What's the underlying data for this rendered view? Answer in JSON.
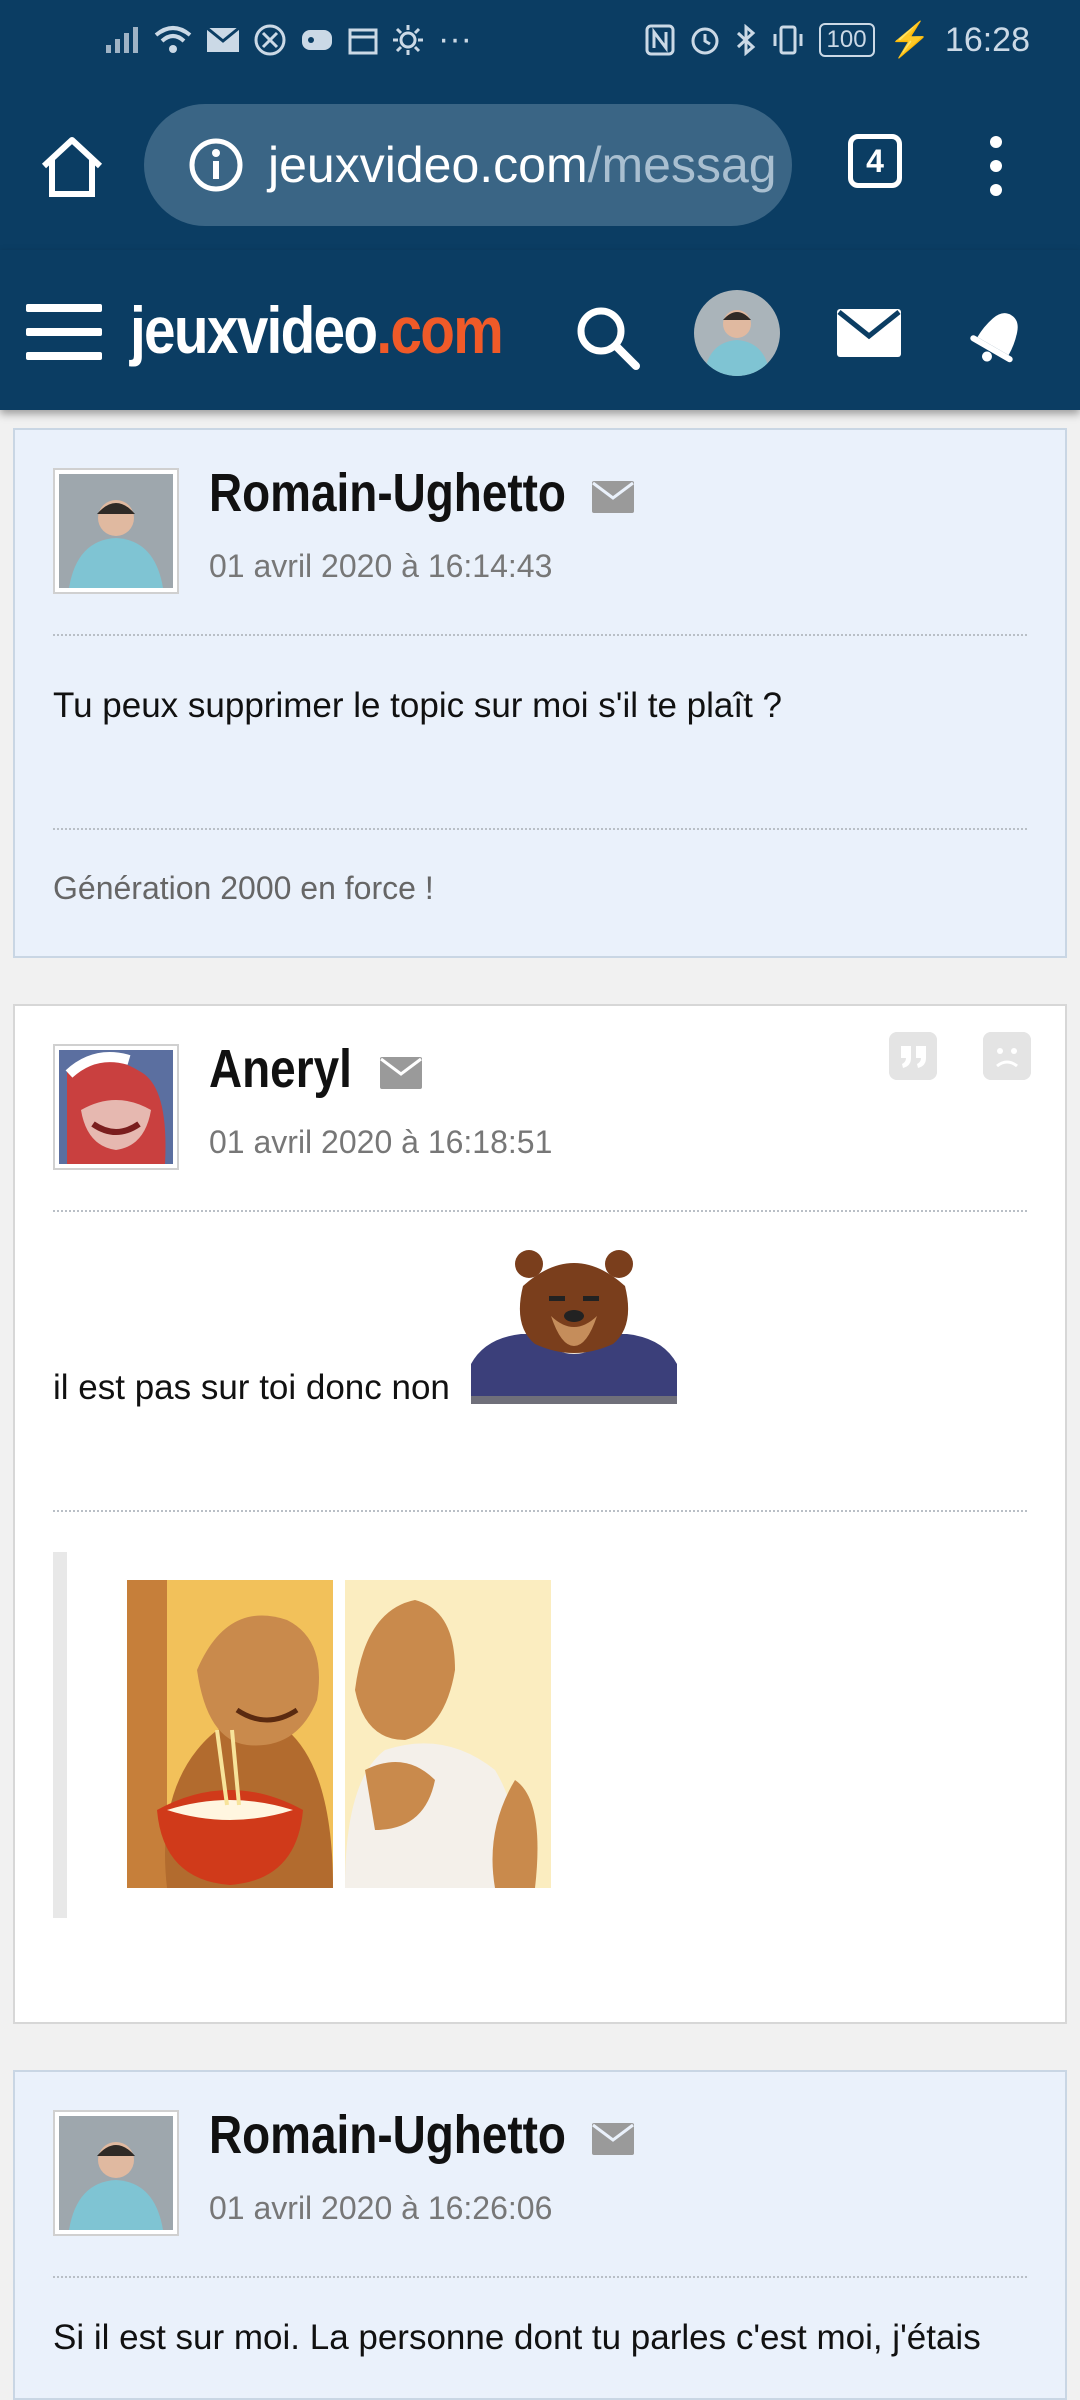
{
  "status_bar": {
    "battery": "100",
    "time": "16:28"
  },
  "browser": {
    "url_domain": "jeuxvideo.com",
    "url_path": "/messag",
    "tab_count": "4"
  },
  "site": {
    "logo_main": "jeuxvideo",
    "logo_suffix": ".com"
  },
  "posts": [
    {
      "author": "Romain-Ughetto",
      "date": "01 avril 2020 à 16:14:43",
      "message": "Tu peux supprimer le topic sur moi s'il te plaît ?",
      "signature": "Génération 2000 en force !"
    },
    {
      "author": "Aneryl",
      "date": "01 avril 2020 à 16:18:51",
      "message": "il est pas sur toi donc non"
    },
    {
      "author": "Romain-Ughetto",
      "date": "01 avril 2020 à 16:26:06",
      "message": "Si il est sur moi. La personne dont tu parles c'est moi, j'étais"
    }
  ],
  "colors": {
    "header_bg": "#0b3d63",
    "accent": "#f05a28",
    "post_blue_bg": "#eaf1fb"
  },
  "icons": [
    "home-icon",
    "info-icon",
    "tabs-icon",
    "more-vert-icon",
    "hamburger-icon",
    "search-icon",
    "avatar",
    "mail-icon",
    "bell-icon",
    "quote-icon",
    "report-icon"
  ]
}
